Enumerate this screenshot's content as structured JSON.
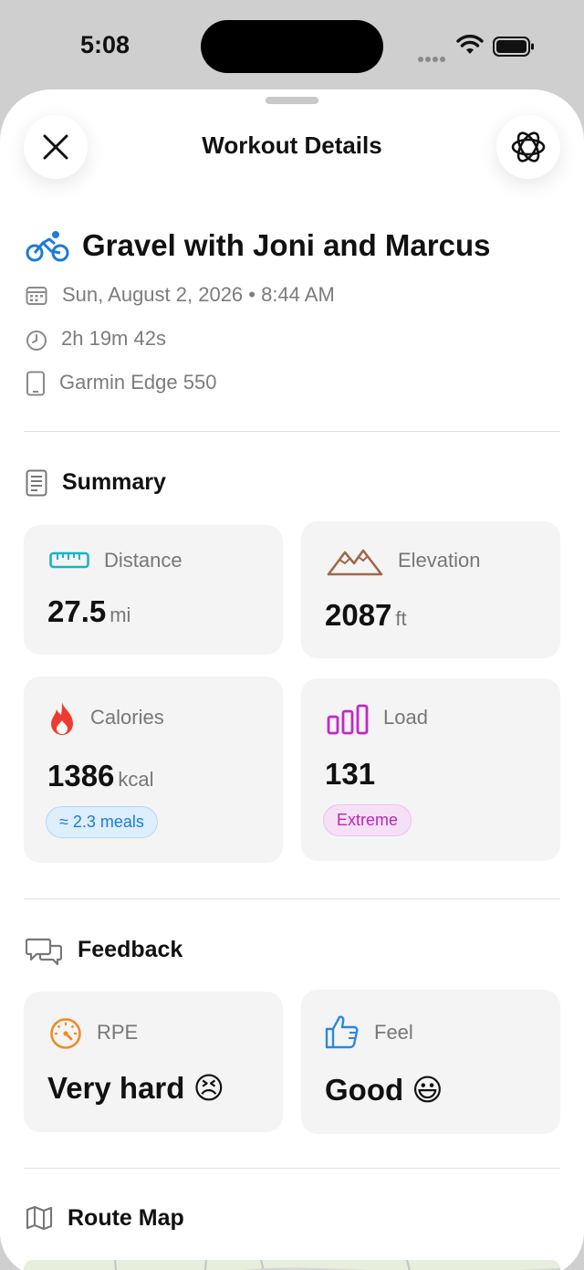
{
  "status_bar": {
    "time": "5:08"
  },
  "header": {
    "title": "Workout Details"
  },
  "workout": {
    "title": "Gravel with Joni and Marcus",
    "date_time": "Sun, August 2, 2026 • 8:44 AM",
    "duration": "2h 19m 42s",
    "device": "Garmin Edge 550"
  },
  "summary": {
    "heading": "Summary",
    "distance": {
      "label": "Distance",
      "value": "27.5",
      "unit": "mi"
    },
    "elevation": {
      "label": "Elevation",
      "value": "2087",
      "unit": "ft"
    },
    "calories": {
      "label": "Calories",
      "value": "1386",
      "unit": "kcal",
      "badge": "≈ 2.3 meals"
    },
    "load": {
      "label": "Load",
      "value": "131",
      "badge": "Extreme"
    }
  },
  "feedback": {
    "heading": "Feedback",
    "rpe": {
      "label": "RPE",
      "value": "Very hard 😣"
    },
    "feel": {
      "label": "Feel",
      "value": "Good 😃"
    }
  },
  "route": {
    "heading": "Route Map"
  },
  "colors": {
    "cycling_blue": "#1c7cd6",
    "distance_teal": "#1bb3c4",
    "elevation_brown": "#a0684a",
    "calories_red": "#ef3b2f",
    "load_purple": "#c02ac4",
    "rpe_orange": "#f08a24",
    "feel_blue": "#2a87e0"
  }
}
